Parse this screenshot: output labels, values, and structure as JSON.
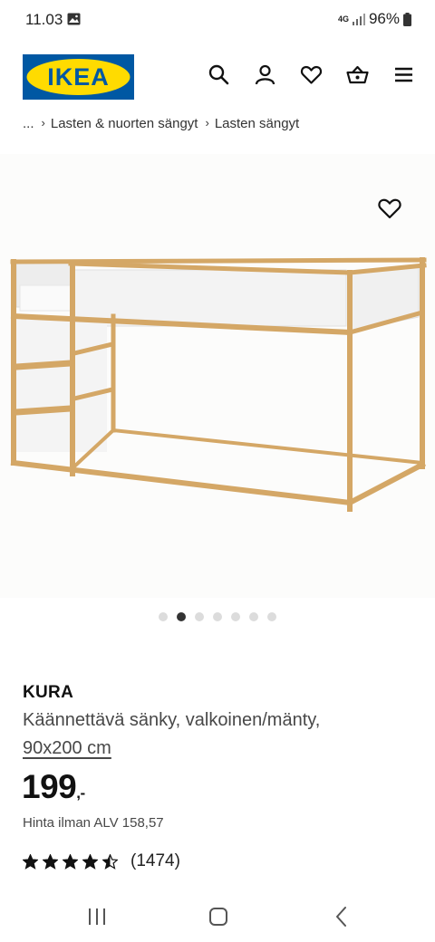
{
  "status_bar": {
    "time": "11.03",
    "network": "4G",
    "battery": "96%",
    "icons": [
      "image-notification-icon",
      "signal-icon",
      "battery-icon"
    ]
  },
  "header": {
    "logo_text": "IKEA",
    "brand_colors": {
      "blue": "#0058a3",
      "yellow": "#ffdb00"
    },
    "icons": [
      "search-icon",
      "account-icon",
      "heart-icon",
      "basket-icon",
      "menu-icon"
    ]
  },
  "breadcrumb": {
    "ellipsis": "...",
    "items": [
      "Lasten & nuorten sängyt",
      "Lasten sängyt"
    ]
  },
  "gallery": {
    "image_count": 7,
    "active_index": 1,
    "favorite_icon": "heart-outline-icon"
  },
  "product": {
    "name": "KURA",
    "description": "Käännettävä sänky, valkoinen/mänty,",
    "size": "90x200 cm",
    "price": "199",
    "price_suffix": ",-",
    "price_excl_vat": "Hinta ilman ALV 158,57",
    "rating_value": 4.5,
    "rating_max": 5,
    "review_count": "(1474)"
  },
  "nav_bar": {
    "icons": [
      "recent-apps-icon",
      "home-icon",
      "back-icon"
    ]
  }
}
